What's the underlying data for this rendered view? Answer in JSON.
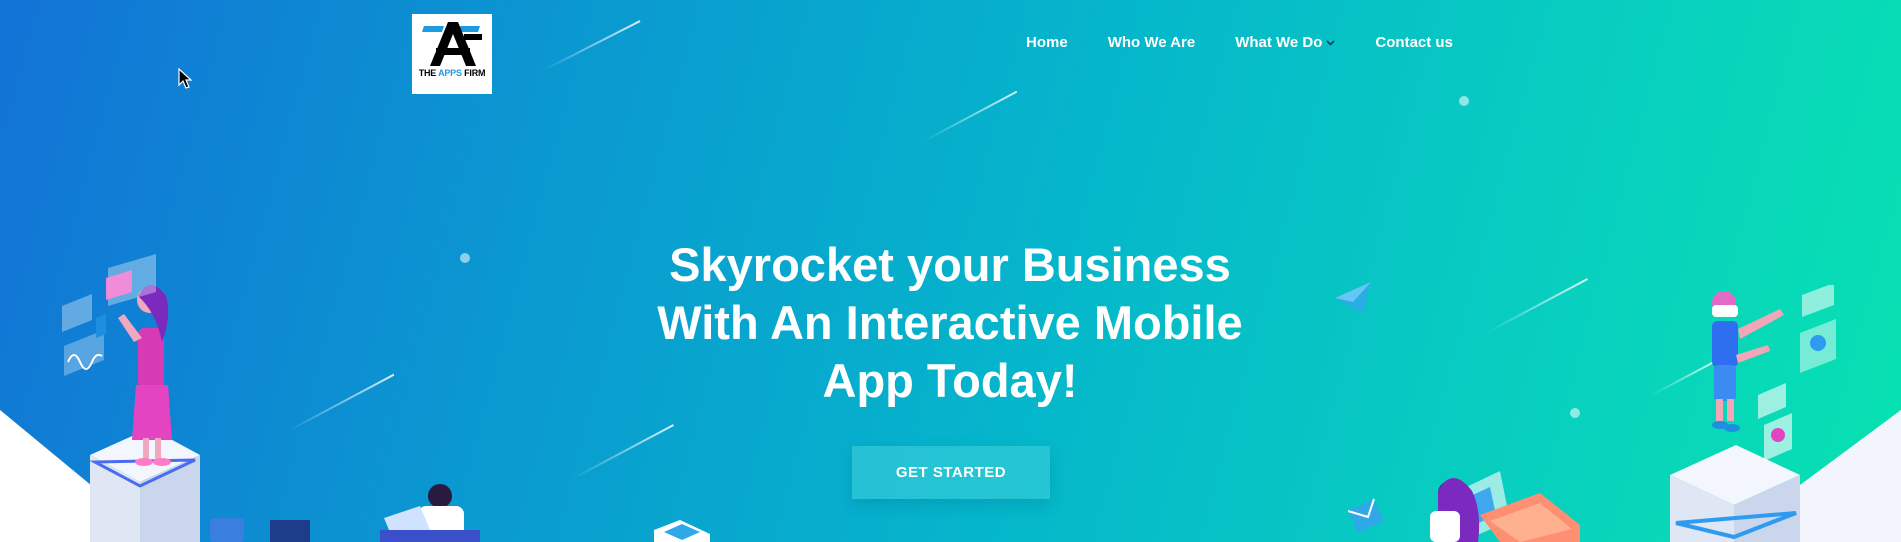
{
  "brand": {
    "logo_letters": "AF",
    "logo_text_pre": "THE ",
    "logo_text_accent": "APPS",
    "logo_text_post": " FIRM"
  },
  "nav": {
    "items": [
      {
        "label": "Home"
      },
      {
        "label": "Who We Are"
      },
      {
        "label": "What We Do",
        "has_dropdown": true
      },
      {
        "label": "Contact us"
      }
    ]
  },
  "hero": {
    "headline_lines": [
      "Skyrocket your Business",
      "With An Interactive Mobile",
      "App Today!"
    ],
    "cta_label": "GET STARTED"
  },
  "icons": {
    "dropdown": "chevron-down-icon",
    "pointer": "mouse-cursor-icon"
  },
  "colors": {
    "gradient_start": "#1273d6",
    "gradient_end": "#07e2b0",
    "logo_accent": "#1e9be0",
    "text": "#ffffff"
  }
}
